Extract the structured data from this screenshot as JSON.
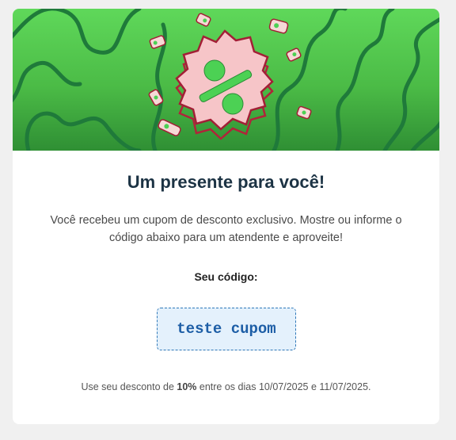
{
  "banner": {
    "icon": "discount-badge-icon"
  },
  "title": "Um presente para você!",
  "description": "Você recebeu um cupom de desconto exclusivo. Mostre ou informe o código abaixo para um atendente e aproveite!",
  "code_label": "Seu código:",
  "code": "teste cupom",
  "footer": {
    "prefix": "Use seu desconto de ",
    "discount": "10%",
    "suffix": " entre os dias 10/07/2025 e 11/07/2025."
  },
  "colors": {
    "banner_green": "#4bbb46",
    "title": "#1c3344",
    "code_text": "#1d5ea6",
    "code_bg": "#e4f1fc"
  }
}
